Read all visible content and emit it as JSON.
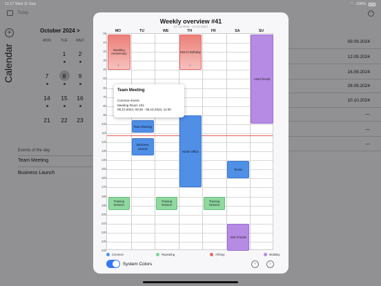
{
  "status": {
    "time": "11:17",
    "date": "Wed 11 Sep",
    "battery": "100%"
  },
  "background": {
    "toolbar_today": "Today",
    "side_title": "Calendar",
    "month": "October 2024",
    "month_chevron": ">",
    "weekday_heads": [
      "MON",
      "TUE",
      "WED"
    ],
    "weeks": [
      [
        "",
        "1",
        "2"
      ],
      [
        "7",
        "8",
        "9"
      ],
      [
        "14",
        "15",
        "16"
      ],
      [
        "21",
        "22",
        "23"
      ]
    ],
    "events_title": "Events of the day",
    "events": [
      "Team Meeting",
      "Business Launch"
    ],
    "right_list": [
      "09.09.2024",
      "12.09.2024",
      "16.09.2024",
      "28.09.2024",
      "10.10.2024",
      "—",
      "—",
      "—"
    ]
  },
  "modal": {
    "title": "Weekly overview #41",
    "subtitle": "07.10.2024 - 13.10.2024",
    "days": [
      "MO",
      "TU",
      "WE",
      "TH",
      "FR",
      "SA",
      "SU"
    ],
    "hours": [
      "0h",
      "1h",
      "2h",
      "3h",
      "4h",
      "5h",
      "6h",
      "7h",
      "8h",
      "9h",
      "10h",
      "11h",
      "12h",
      "13h",
      "14h",
      "15h",
      "16h",
      "17h",
      "18h",
      "19h",
      "20h",
      "21h",
      "22h",
      "23h",
      "24h"
    ],
    "events": [
      {
        "name": "Wedding Anniversary",
        "color": "red",
        "day": 0,
        "start": 0,
        "end": 4,
        "arrow": true
      },
      {
        "name": "Mom's Birthday",
        "color": "red",
        "day": 3,
        "start": 0,
        "end": 4,
        "arrow": true
      },
      {
        "name": "Visit Friends",
        "color": "purple",
        "day": 6,
        "start": 0,
        "end": 10
      },
      {
        "name": "Team Meeting",
        "color": "blue",
        "day": 1,
        "start": 9.5,
        "end": 11
      },
      {
        "name": "Business Launch",
        "color": "blue",
        "day": 1,
        "start": 11.5,
        "end": 13.5
      },
      {
        "name": "Home Office",
        "color": "blue",
        "day": 3,
        "start": 9,
        "end": 17
      },
      {
        "name": "Tennis",
        "color": "blue",
        "day": 5,
        "start": 14,
        "end": 16
      },
      {
        "name": "Training Session",
        "color": "green",
        "day": 0,
        "start": 18,
        "end": 19.5
      },
      {
        "name": "Training Session",
        "color": "green",
        "day": 2,
        "start": 18,
        "end": 19.5
      },
      {
        "name": "Training Session",
        "color": "green",
        "day": 4,
        "start": 18,
        "end": 19.5
      },
      {
        "name": "Visit Friends",
        "color": "purple",
        "day": 5,
        "start": 21,
        "end": 24
      }
    ],
    "now_hour": 11.25,
    "popover": {
      "title": "Team Meeting",
      "line1": "Common Event",
      "line2": "Meeting Room 101",
      "line3": "08.10.2024, 09:30 - 08.10.2024, 11:00"
    },
    "legend": [
      {
        "label": "Common",
        "color": "#4f8fe6"
      },
      {
        "label": "Repeating",
        "color": "#7fd394"
      },
      {
        "label": "All-Day",
        "color": "#e8665f"
      },
      {
        "label": "Multiday",
        "color": "#b58be4"
      }
    ],
    "toggle_label": "System Colors",
    "prev": "‹",
    "next": "›"
  }
}
